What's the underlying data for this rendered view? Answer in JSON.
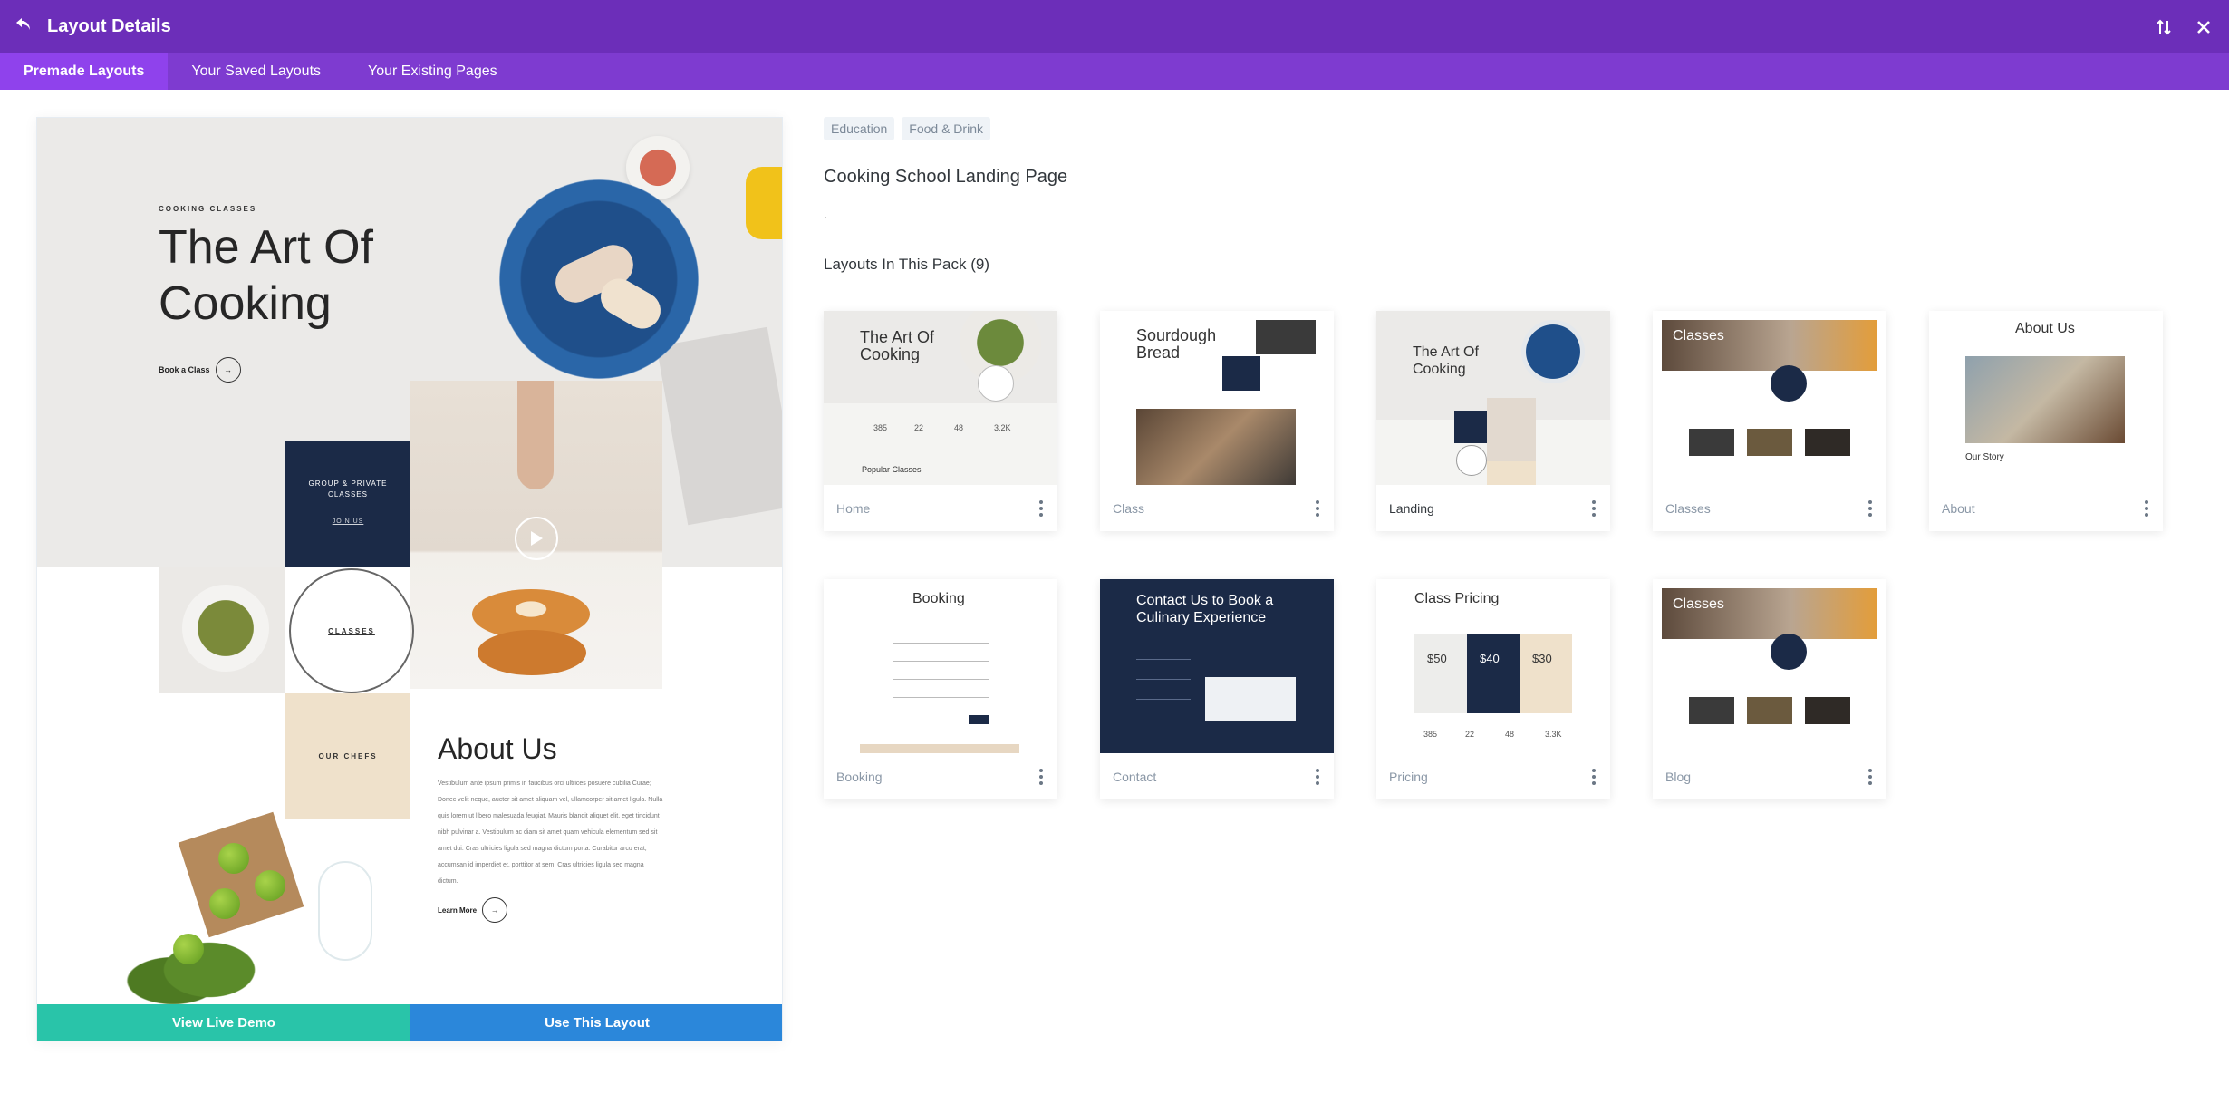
{
  "header": {
    "title": "Layout Details",
    "back_icon": "undo-arrow-icon",
    "sort_icon": "sort-arrows-icon",
    "close_icon": "close-icon"
  },
  "tabs": [
    {
      "label": "Premade Layouts",
      "active": true
    },
    {
      "label": "Your Saved Layouts",
      "active": false
    },
    {
      "label": "Your Existing Pages",
      "active": false
    }
  ],
  "preview": {
    "eyebrow": "COOKING CLASSES",
    "heading_line1": "The Art Of",
    "heading_line2": "Cooking",
    "book_label": "Book a Class",
    "group_label_line1": "GROUP & PRIVATE",
    "group_label_line2": "CLASSES",
    "join_label": "JOIN US",
    "classes_label": "CLASSES",
    "chefs_label": "OUR CHEFS",
    "about_heading": "About Us",
    "about_text": "Vestibulum ante ipsum primis in faucibus orci ultrices posuere cubilia Curae; Donec velit neque, auctor sit amet aliquam vel, ullamcorper sit amet ligula. Nulla quis lorem ut libero malesuada feugiat. Mauris blandit aliquet elit, eget tincidunt nibh pulvinar a. Vestibulum ac diam sit amet quam vehicula elementum sed sit amet dui. Cras ultricies ligula sed magna dictum porta. Curabitur arcu erat, accumsan id imperdiet et, porttitor at sem. Cras ultricies ligula sed magna dictum.",
    "learn_more": "Learn More",
    "view_demo_label": "View Live Demo",
    "use_layout_label": "Use This Layout",
    "colors": {
      "demo": "#29c4a9",
      "use": "#2b87da"
    }
  },
  "details": {
    "tags": [
      "Education",
      "Food & Drink"
    ],
    "title": "Cooking School Landing Page",
    "description": ".",
    "pack_heading": "Layouts In This Pack (9)"
  },
  "cards": [
    {
      "label": "Home",
      "selected": false,
      "thumb": {
        "title_line1": "The Art Of",
        "title_line2": "Cooking",
        "stats": [
          "385",
          "22",
          "48",
          "3.2K"
        ],
        "sub": "Popular Classes"
      }
    },
    {
      "label": "Class",
      "selected": false,
      "thumb": {
        "title_line1": "Sourdough",
        "title_line2": "Bread"
      }
    },
    {
      "label": "Landing",
      "selected": true,
      "thumb": {
        "title_line1": "The Art Of",
        "title_line2": "Cooking"
      }
    },
    {
      "label": "Classes",
      "selected": false,
      "thumb": {
        "title_line1": "Classes"
      }
    },
    {
      "label": "About",
      "selected": false,
      "thumb": {
        "title_line1": "About Us",
        "sub": "Our Story"
      }
    },
    {
      "label": "Booking",
      "selected": false,
      "thumb": {
        "title_line1": "Booking"
      }
    },
    {
      "label": "Contact",
      "selected": false,
      "thumb": {
        "title_line1": "Contact Us to Book a",
        "title_line2": "Culinary Experience"
      }
    },
    {
      "label": "Pricing",
      "selected": false,
      "thumb": {
        "title_line1": "Class Pricing",
        "prices": [
          "$50",
          "$40",
          "$30"
        ],
        "stats": [
          "385",
          "22",
          "48",
          "3.3K"
        ]
      }
    },
    {
      "label": "Blog",
      "selected": false,
      "thumb": {
        "title_line1": "Classes"
      }
    }
  ]
}
